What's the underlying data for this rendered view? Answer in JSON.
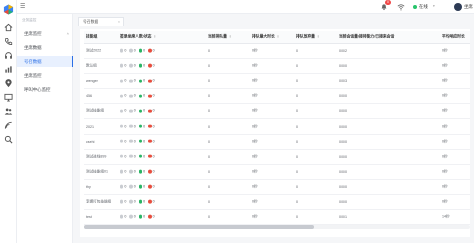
{
  "icons": {
    "logo": "app-logo",
    "rail": [
      "home-icon",
      "phone-icon",
      "headset-icon",
      "chart-icon",
      "location-icon",
      "monitor-icon",
      "users-icon",
      "signal-icon",
      "search-icon"
    ]
  },
  "topbar": {
    "menu_icon": "☰",
    "notification_count": "0",
    "status_label": "在线",
    "user_name": "坐席"
  },
  "sidebar": {
    "section_title": "业务监控",
    "items": [
      {
        "label": "坐席监控"
      },
      {
        "label": "坐席数据"
      },
      {
        "label": "号召数据",
        "active": true
      },
      {
        "label": "坐席监控"
      },
      {
        "label": "呼叫中心监控"
      }
    ]
  },
  "tab": {
    "label": "号召数据",
    "close": "×"
  },
  "table": {
    "headers": [
      "技能组",
      "签录坐席人数/状态",
      "当前排队量",
      "排队最大时长",
      "排队放弃量",
      "当前会话量/接待能力/已接来会话",
      "平均响应时长"
    ],
    "rows": [
      {
        "name": "测试2022",
        "s1": "0",
        "s2": "0",
        "s3": "0",
        "s4": "0",
        "queue": "0",
        "max_wait": "0秒",
        "abandon": "0",
        "sessions": "0/0/2",
        "avg": "0秒"
      },
      {
        "name": "默认组",
        "s1": "0",
        "s2": "0",
        "s3": "0",
        "s4": "0",
        "queue": "0",
        "max_wait": "0秒",
        "abandon": "0",
        "sessions": "0/0/0",
        "avg": "0秒"
      },
      {
        "name": "wenger",
        "s1": "0",
        "s2": "0",
        "s3": "0",
        "s4": "0",
        "queue": "0",
        "max_wait": "0秒",
        "abandon": "0",
        "sessions": "0/0/3",
        "avg": "0秒"
      },
      {
        "name": "456",
        "s1": "0",
        "s2": "0",
        "s3": "0",
        "s4": "0",
        "queue": "0",
        "max_wait": "0秒",
        "abandon": "0",
        "sessions": "0/0/0",
        "avg": "0秒"
      },
      {
        "name": "测试技能组",
        "s1": "0",
        "s2": "0",
        "s3": "0",
        "s4": "0",
        "queue": "0",
        "max_wait": "0秒",
        "abandon": "0",
        "sessions": "0/0/0",
        "avg": "0秒"
      },
      {
        "name": "2021",
        "s1": "0",
        "s2": "0",
        "s3": "0",
        "s4": "0",
        "queue": "0",
        "max_wait": "0秒",
        "abandon": "0",
        "sessions": "0/0/0",
        "avg": "0秒"
      },
      {
        "name": "csehi",
        "s1": "0",
        "s2": "0",
        "s3": "0",
        "s4": "0",
        "queue": "0",
        "max_wait": "0秒",
        "abandon": "0",
        "sessions": "0/0/0",
        "avg": "0秒"
      },
      {
        "name": "测试进线899",
        "s1": "0",
        "s2": "0",
        "s3": "0",
        "s4": "0",
        "queue": "0",
        "max_wait": "0秒",
        "abandon": "0",
        "sessions": "0/0/0",
        "avg": "0秒"
      },
      {
        "name": "测试技能组01",
        "s1": "0",
        "s2": "0",
        "s3": "0",
        "s4": "0",
        "queue": "0",
        "max_wait": "0秒",
        "abandon": "0",
        "sessions": "0/0/0",
        "avg": "0秒"
      },
      {
        "name": "thy",
        "s1": "0",
        "s2": "0",
        "s3": "0",
        "s4": "0",
        "queue": "0",
        "max_wait": "0秒",
        "abandon": "0",
        "sessions": "0/0/0",
        "avg": "0秒"
      },
      {
        "name": "李娜打包技能组",
        "s1": "0",
        "s2": "0",
        "s3": "0",
        "s4": "0",
        "queue": "0",
        "max_wait": "0秒",
        "abandon": "0",
        "sessions": "0/0/0",
        "avg": "0秒"
      },
      {
        "name": "test",
        "s1": "0",
        "s2": "0",
        "s3": "0",
        "s4": "0",
        "queue": "0",
        "max_wait": "0秒",
        "abandon": "0",
        "sessions": "0/0/1",
        "avg": "14秒"
      }
    ]
  },
  "colors": {
    "accent": "#2b6fe6",
    "online": "#27c46b",
    "badge": "#f04848"
  }
}
